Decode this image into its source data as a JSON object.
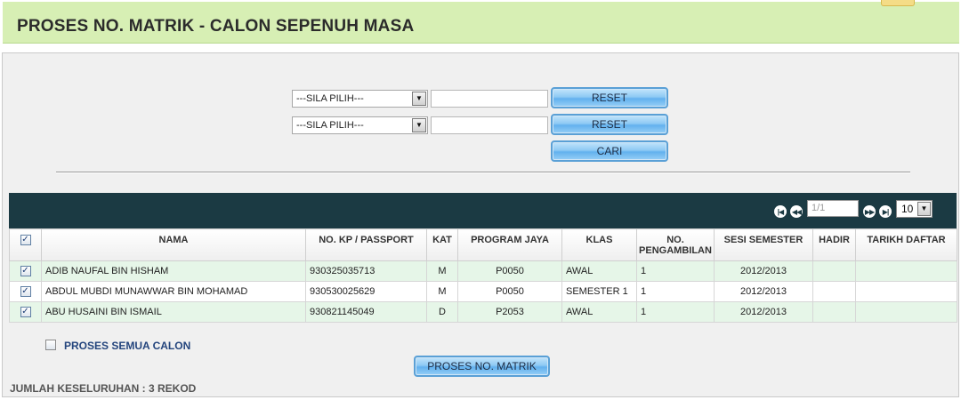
{
  "header": {
    "title": "PROSES NO. MATRIK - CALON SEPENUH MASA"
  },
  "filters": {
    "row1": {
      "select_value": "---SILA PILIH---",
      "input_value": "",
      "reset_label": "RESET"
    },
    "row2": {
      "select_value": "---SILA PILIH---",
      "input_value": "",
      "reset_label": "RESET"
    },
    "search_label": "CARI"
  },
  "pager": {
    "page": "1/1",
    "page_size": "10"
  },
  "table": {
    "columns": [
      "NAMA",
      "NO. KP / PASSPORT",
      "KAT",
      "PROGRAM JAYA",
      "KLAS",
      "NO. PENGAMBILAN",
      "SESI SEMESTER",
      "HADIR",
      "TARIKH DAFTAR"
    ],
    "rows": [
      {
        "checked": true,
        "nama": "ADIB NAUFAL BIN HISHAM",
        "kp": "930325035713",
        "kat": "M",
        "program": "P0050",
        "klas": "AWAL",
        "pengambilan": "1",
        "sesi": "2012/2013",
        "hadir": "",
        "tarikh": ""
      },
      {
        "checked": true,
        "nama": "ABDUL MUBDI MUNAWWAR BIN MOHAMAD",
        "kp": "930530025629",
        "kat": "M",
        "program": "P0050",
        "klas": "SEMESTER 1",
        "pengambilan": "1",
        "sesi": "2012/2013",
        "hadir": "",
        "tarikh": ""
      },
      {
        "checked": true,
        "nama": "ABU HUSAINI BIN ISMAIL",
        "kp": "930821145049",
        "kat": "D",
        "program": "P2053",
        "klas": "AWAL",
        "pengambilan": "1",
        "sesi": "2012/2013",
        "hadir": "",
        "tarikh": ""
      }
    ]
  },
  "proses_semua": {
    "label": "PROSES SEMUA CALON",
    "checked": false
  },
  "proses_button": "PROSES NO. MATRIK",
  "footer": {
    "count": "JUMLAH KESELURUHAN : 3 REKOD"
  }
}
